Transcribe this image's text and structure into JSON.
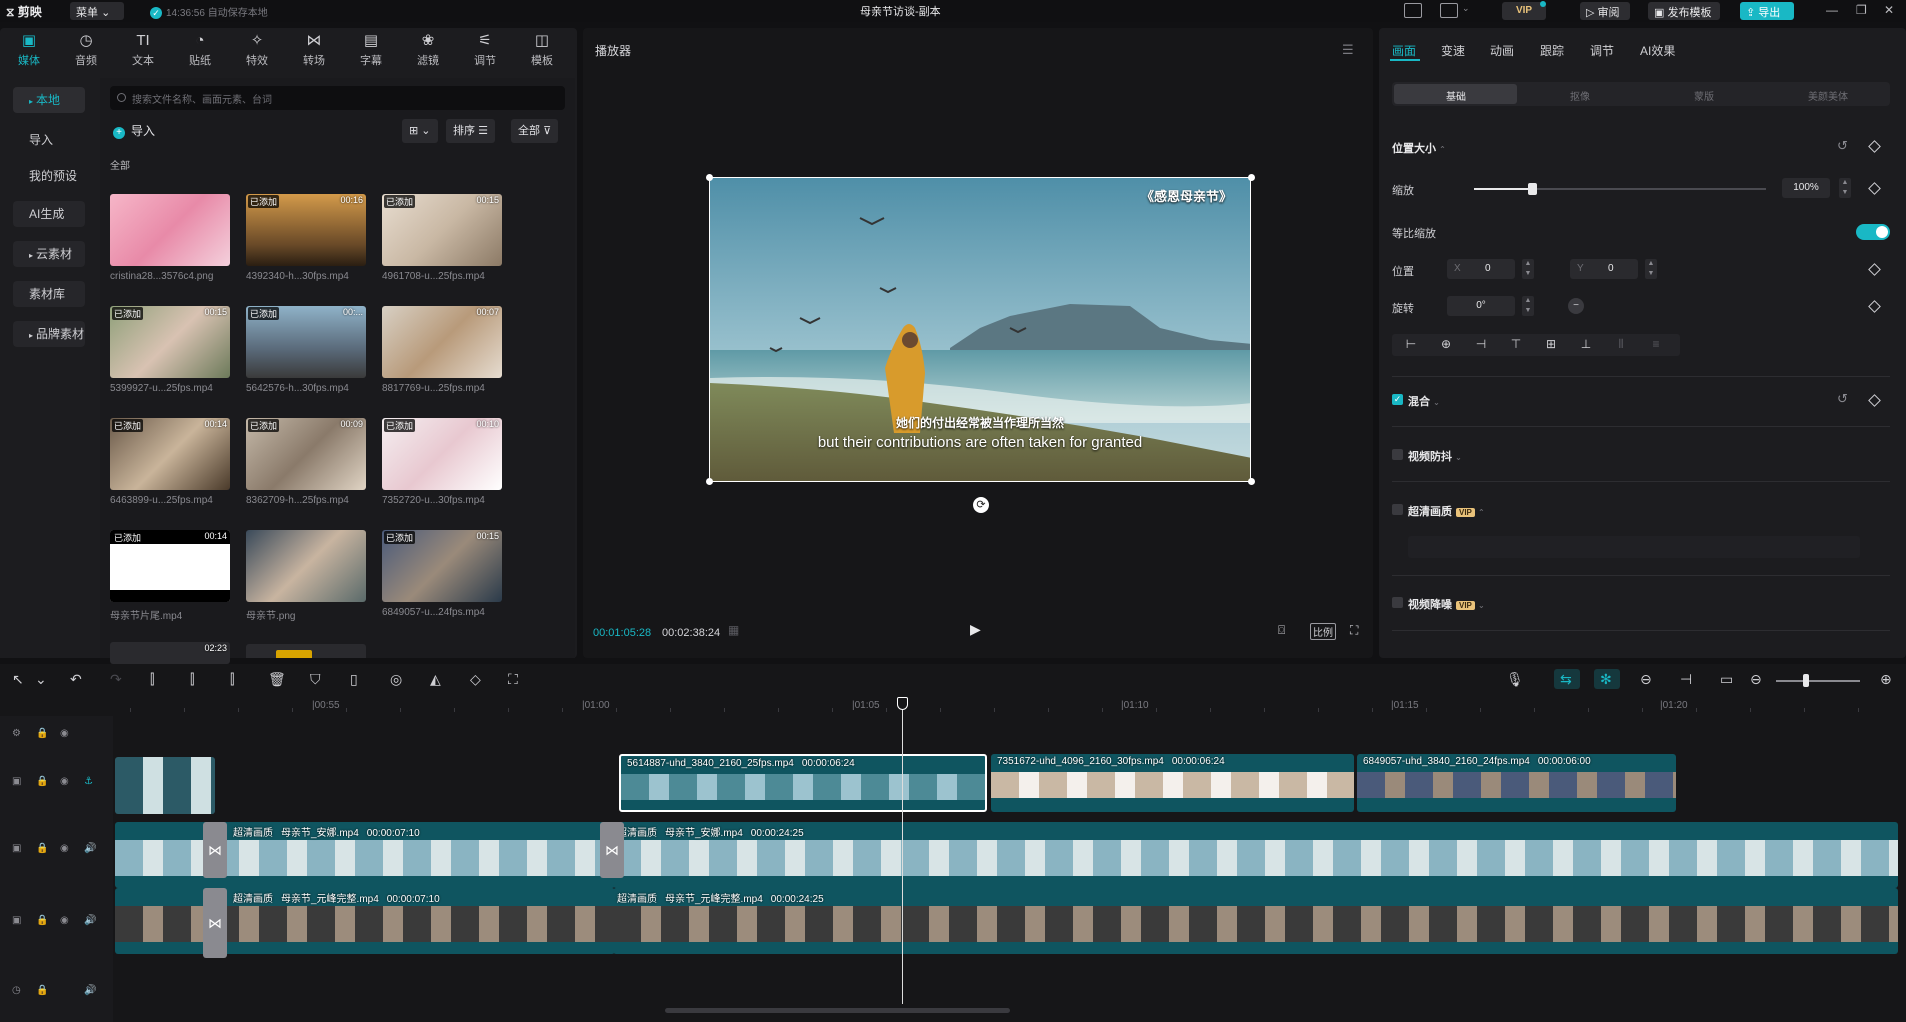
{
  "titlebar": {
    "logo": "剪映",
    "menu": "菜单",
    "autosave": "14:36:56 自动保存本地",
    "project_title": "母亲节访谈-副本",
    "vip": "VIP",
    "review": "审阅",
    "publish_template": "发布模板",
    "export": "导出"
  },
  "tool_tabs": [
    {
      "label": "媒体",
      "icon": "media-icon",
      "glyph": "▣"
    },
    {
      "label": "音频",
      "icon": "audio-icon",
      "glyph": "◷"
    },
    {
      "label": "文本",
      "icon": "text-icon",
      "glyph": "TI"
    },
    {
      "label": "贴纸",
      "icon": "sticker-icon",
      "glyph": "◔"
    },
    {
      "label": "特效",
      "icon": "effect-icon",
      "glyph": "✧"
    },
    {
      "label": "转场",
      "icon": "transition-icon",
      "glyph": "⋈"
    },
    {
      "label": "字幕",
      "icon": "caption-icon",
      "glyph": "▤"
    },
    {
      "label": "滤镜",
      "icon": "filter-icon",
      "glyph": "❀"
    },
    {
      "label": "调节",
      "icon": "adjust-icon",
      "glyph": "⚟"
    },
    {
      "label": "模板",
      "icon": "template-icon",
      "glyph": "◫"
    }
  ],
  "sidebar": {
    "items": [
      {
        "label": "本地",
        "tri": "▸"
      },
      {
        "label": "导入",
        "tri": ""
      },
      {
        "label": "我的预设",
        "tri": ""
      },
      {
        "label": "AI生成",
        "tri": ""
      },
      {
        "label": "云素材",
        "tri": "▸"
      },
      {
        "label": "素材库",
        "tri": ""
      },
      {
        "label": "品牌素材",
        "tri": "▸"
      }
    ]
  },
  "media": {
    "search_placeholder": "搜索文件名称、画面元素、台词",
    "import_label": "导入",
    "sort_label": "排序",
    "filter_label": "全部",
    "all_label": "全部",
    "items": [
      {
        "name": "cristina28...3576c4.png",
        "badge": "",
        "duration": ""
      },
      {
        "name": "4392340-h...30fps.mp4",
        "badge": "已添加",
        "duration": "00:16"
      },
      {
        "name": "4961708-u...25fps.mp4",
        "badge": "已添加",
        "duration": "00:15"
      },
      {
        "name": "5399927-u...25fps.mp4",
        "badge": "已添加",
        "duration": "00:15"
      },
      {
        "name": "5642576-h...30fps.mp4",
        "badge": "已添加",
        "duration": "00:..."
      },
      {
        "name": "8817769-u...25fps.mp4",
        "badge": "",
        "duration": "00:07"
      },
      {
        "name": "6463899-u...25fps.mp4",
        "badge": "已添加",
        "duration": "00:14"
      },
      {
        "name": "8362709-h...25fps.mp4",
        "badge": "已添加",
        "duration": "00:09"
      },
      {
        "name": "7352720-u...30fps.mp4",
        "badge": "已添加",
        "duration": "00:10"
      },
      {
        "name": "母亲节片尾.mp4",
        "badge": "已添加",
        "duration": "00:14"
      },
      {
        "name": "母亲节.png",
        "badge": "",
        "duration": ""
      },
      {
        "name": "6849057-u...24fps.mp4",
        "badge": "已添加",
        "duration": "00:15"
      },
      {
        "name": "",
        "badge": "",
        "duration": "02:23"
      }
    ]
  },
  "player": {
    "title": "播放器",
    "video_title": "《感恩母亲节》",
    "subtitle_cn": "她们的付出经常被当作理所当然",
    "subtitle_en": "but their contributions are often taken for granted",
    "current_time": "00:01:05:28",
    "total_time": "00:02:38:24",
    "ratio_label": "比例"
  },
  "inspector": {
    "tabs": [
      "画面",
      "变速",
      "动画",
      "跟踪",
      "调节",
      "AI效果"
    ],
    "sub_tabs": [
      "基础",
      "抠像",
      "蒙版",
      "美颜美体"
    ],
    "position_size": "位置大小",
    "scale_label": "缩放",
    "scale_value": "100%",
    "scale_fraction": 0.2,
    "uniform_scale": "等比缩放",
    "position_label": "位置",
    "x_label": "X",
    "x_value": "0",
    "y_label": "Y",
    "y_value": "0",
    "rotate_label": "旋转",
    "rotate_value": "0°",
    "blend": "混合",
    "stabilize": "视频防抖",
    "hd": "超清画质",
    "denoise": "视频降噪",
    "vip_tag": "VIP"
  },
  "timeline": {
    "ruler": [
      "|00:55",
      "|01:00",
      "|01:05",
      "|01:10",
      "|01:15",
      "|01:20"
    ],
    "main_clips": [
      {
        "name": "5614887-uhd_3840_2160_25fps.mp4",
        "duration": "00:00:06:24"
      },
      {
        "name": "7351672-uhd_4096_2160_30fps.mp4",
        "duration": "00:00:06:24"
      },
      {
        "name": "6849057-uhd_3840_2160_24fps.mp4",
        "duration": "00:00:06:00"
      }
    ],
    "track2_clips": [
      {
        "tag": "超清画质",
        "name": "母亲节_安娜.mp4",
        "duration": "00:00:07:10"
      },
      {
        "tag": "超清画质",
        "name": "母亲节_安娜.mp4",
        "duration": "00:00:24:25"
      }
    ],
    "track3_clips": [
      {
        "tag": "超清画质",
        "name": "母亲节_元峰完整.mp4",
        "duration": "00:00:07:10"
      },
      {
        "tag": "超清画质",
        "name": "母亲节_元峰完整.mp4",
        "duration": "00:00:24:25"
      }
    ]
  }
}
